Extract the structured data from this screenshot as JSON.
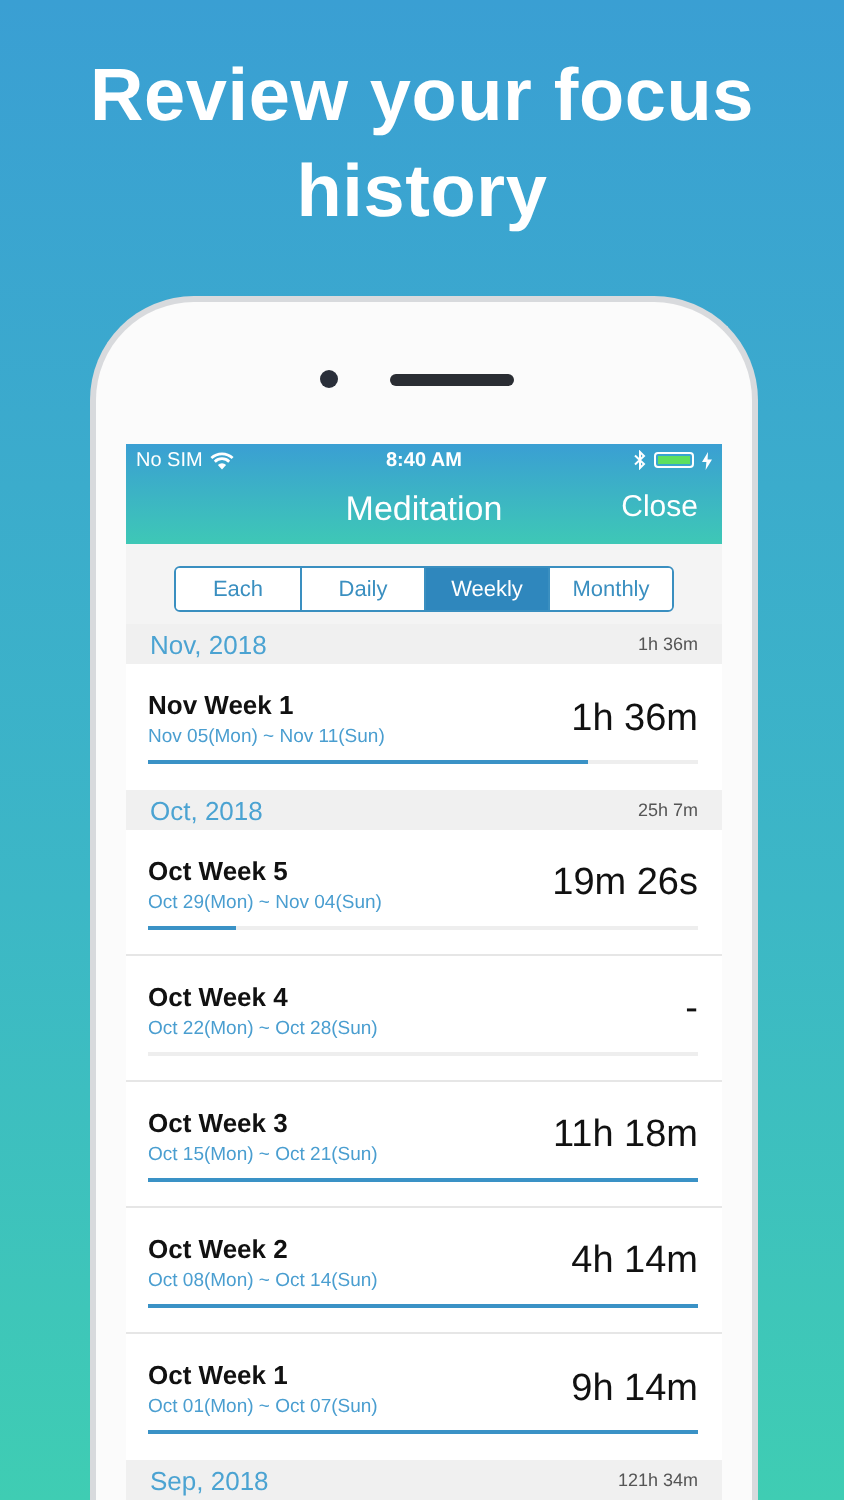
{
  "headline": "Review your focus history",
  "status_bar": {
    "carrier": "No SIM",
    "time": "8:40 AM"
  },
  "nav": {
    "title": "Meditation",
    "close": "Close"
  },
  "tabs": [
    {
      "label": "Each",
      "selected": false
    },
    {
      "label": "Daily",
      "selected": false
    },
    {
      "label": "Weekly",
      "selected": true
    },
    {
      "label": "Monthly",
      "selected": false
    }
  ],
  "sections": [
    {
      "month": "Nov, 2018",
      "total": "1h 36m",
      "weeks": [
        {
          "name": "Nov Week 1",
          "range": "Nov 05(Mon) ~ Nov 11(Sun)",
          "duration": "1h 36m",
          "level": 0.8
        }
      ]
    },
    {
      "month": "Oct, 2018",
      "total": "25h 7m",
      "weeks": [
        {
          "name": "Oct Week 5",
          "range": "Oct 29(Mon) ~ Nov 04(Sun)",
          "duration": "19m 26s",
          "level": 0.16
        },
        {
          "name": "Oct Week 4",
          "range": "Oct 22(Mon) ~ Oct 28(Sun)",
          "duration": "-"
        },
        {
          "name": "Oct Week 3",
          "range": "Oct 15(Mon) ~ Oct 21(Sun)",
          "duration": "11h 18m",
          "level": 1
        },
        {
          "name": "Oct Week 2",
          "range": "Oct 08(Mon) ~ Oct 14(Sun)",
          "duration": "4h 14m",
          "level": 1
        },
        {
          "name": "Oct Week 1",
          "range": "Oct 01(Mon) ~ Oct 07(Sun)",
          "duration": "9h 14m",
          "level": 1
        }
      ]
    },
    {
      "month": "Sep, 2018",
      "total": "121h 34m"
    }
  ]
}
